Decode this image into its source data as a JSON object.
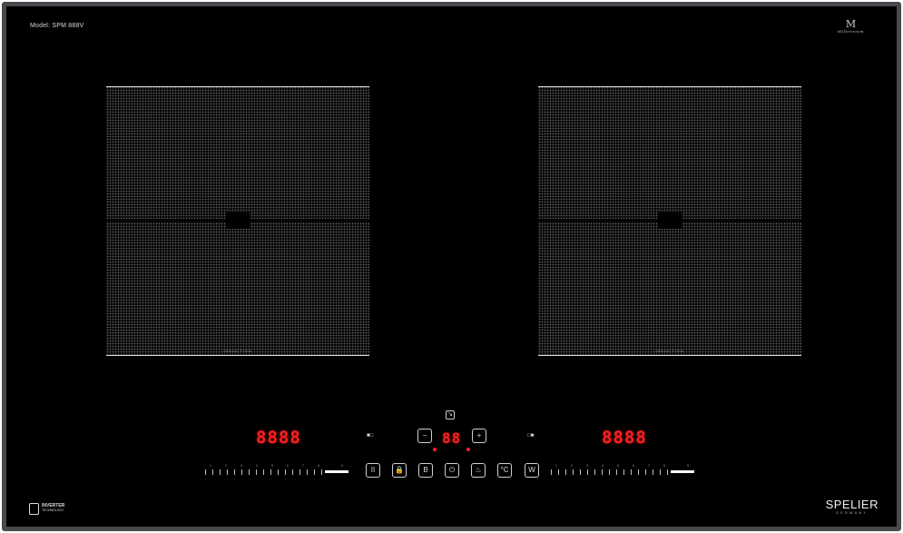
{
  "model_label": "Model: SPM 888V",
  "top_brand": {
    "mark": "M",
    "script": "Millennium"
  },
  "zones": {
    "left": {
      "label": "INDUCTION"
    },
    "right": {
      "label": "INDUCTION"
    }
  },
  "displays": {
    "left": "8888",
    "timer": "88",
    "right": "8888"
  },
  "timer_controls": {
    "minus": "−",
    "plus": "+",
    "indicator": "↘"
  },
  "zone_selectors": {
    "left": "■□",
    "right": "□■"
  },
  "control_buttons": [
    {
      "id": "pause",
      "label": "II"
    },
    {
      "id": "lock",
      "label": "🔒"
    },
    {
      "id": "boost",
      "label": "B"
    },
    {
      "id": "power",
      "label": "⏻"
    },
    {
      "id": "keep-warm",
      "label": "♨"
    },
    {
      "id": "temperature",
      "label": "°C"
    },
    {
      "id": "wattage",
      "label": "W"
    }
  ],
  "slider_numbers": [
    "1",
    "2",
    "3",
    "4",
    "5",
    "6",
    "7",
    "8",
    "9"
  ],
  "inverter": {
    "title": "INVERTER",
    "subtitle": "TECHNOLOGY"
  },
  "bottom_brand": {
    "name": "SPELIER",
    "sub": "GERMANY"
  },
  "colors": {
    "display_red": "#ff1f1f",
    "frame": "#4a4a4e",
    "glass": "#000000"
  }
}
